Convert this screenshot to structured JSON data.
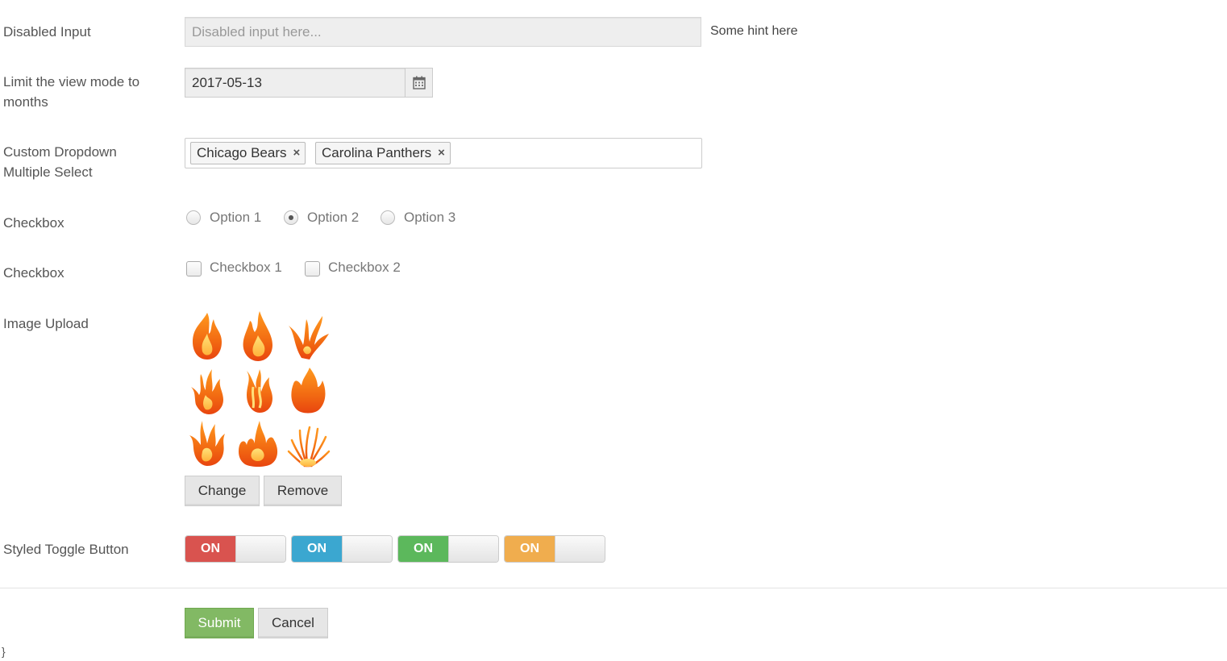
{
  "form": {
    "disabled_input": {
      "label": "Disabled Input",
      "placeholder": "Disabled input here...",
      "hint": "Some hint here"
    },
    "view_mode": {
      "label": "Limit the view mode to months",
      "value": "2017-05-13",
      "icon": "calendar-icon"
    },
    "dropdown": {
      "label": "Custom Dropdown Multiple Select",
      "tags": [
        "Chicago Bears",
        "Carolina Panthers"
      ],
      "remove_glyph": "×"
    },
    "radios": {
      "label": "Checkbox",
      "options": [
        "Option 1",
        "Option 2",
        "Option 3"
      ],
      "selected": "Option 2"
    },
    "checkboxes": {
      "label": "Checkbox",
      "options": [
        "Checkbox 1",
        "Checkbox 2"
      ],
      "checked": []
    },
    "image_upload": {
      "label": "Image Upload",
      "change_label": "Change",
      "remove_label": "Remove"
    },
    "toggles": {
      "label": "Styled Toggle Button",
      "items": [
        {
          "text": "ON",
          "color": "#d9534f"
        },
        {
          "text": "ON",
          "color": "#3ba7d0"
        },
        {
          "text": "ON",
          "color": "#5cb85c"
        },
        {
          "text": "ON",
          "color": "#f0ad4e"
        }
      ]
    },
    "actions": {
      "submit_label": "Submit",
      "cancel_label": "Cancel"
    },
    "stray_text": "}"
  },
  "colors": {
    "submit": "#82b964",
    "flame_outer": "#f47a1f",
    "flame_inner": "#ffd24a"
  }
}
